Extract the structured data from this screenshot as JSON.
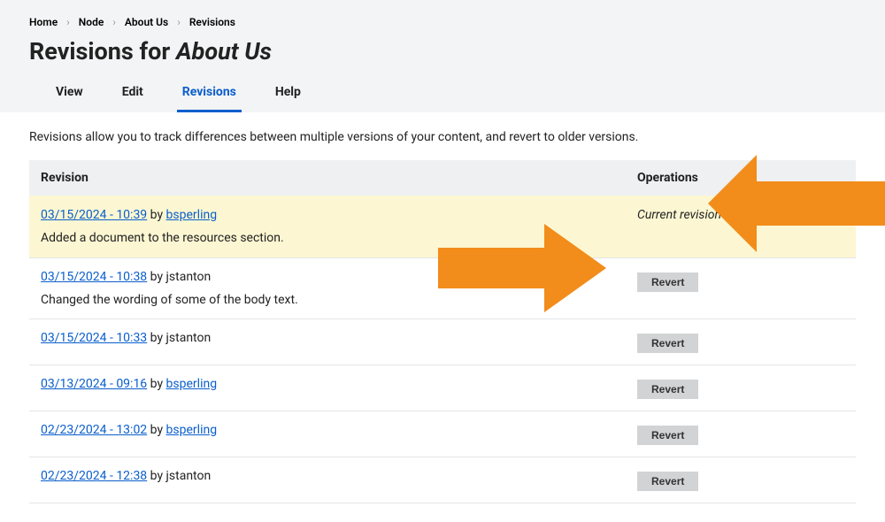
{
  "breadcrumb": {
    "home": "Home",
    "node": "Node",
    "about": "About Us",
    "revisions": "Revisions"
  },
  "title": {
    "prefix": "Revisions for ",
    "italic": "About Us"
  },
  "tabs": {
    "view": "View",
    "edit": "Edit",
    "revisions": "Revisions",
    "help": "Help"
  },
  "intro": "Revisions allow you to track differences between multiple versions of your content, and revert to older versions.",
  "table": {
    "header_revision": "Revision",
    "header_operations": "Operations",
    "by_label": "by",
    "current_label": "Current revision",
    "revert_label": "Revert"
  },
  "rows": [
    {
      "timestamp": "03/15/2024 - 10:39",
      "author": "bsperling",
      "author_link": true,
      "msg": "Added a document to the resources section.",
      "current": true
    },
    {
      "timestamp": "03/15/2024 - 10:38",
      "author": "jstanton",
      "author_link": false,
      "msg": "Changed the wording of some of the body text.",
      "current": false
    },
    {
      "timestamp": "03/15/2024 - 10:33",
      "author": "jstanton",
      "author_link": false,
      "msg": "",
      "current": false
    },
    {
      "timestamp": "03/13/2024 - 09:16",
      "author": "bsperling",
      "author_link": true,
      "msg": "",
      "current": false
    },
    {
      "timestamp": "02/23/2024 - 13:02",
      "author": "bsperling",
      "author_link": true,
      "msg": "",
      "current": false
    },
    {
      "timestamp": "02/23/2024 - 12:38",
      "author": "jstanton",
      "author_link": false,
      "msg": "",
      "current": false
    }
  ]
}
